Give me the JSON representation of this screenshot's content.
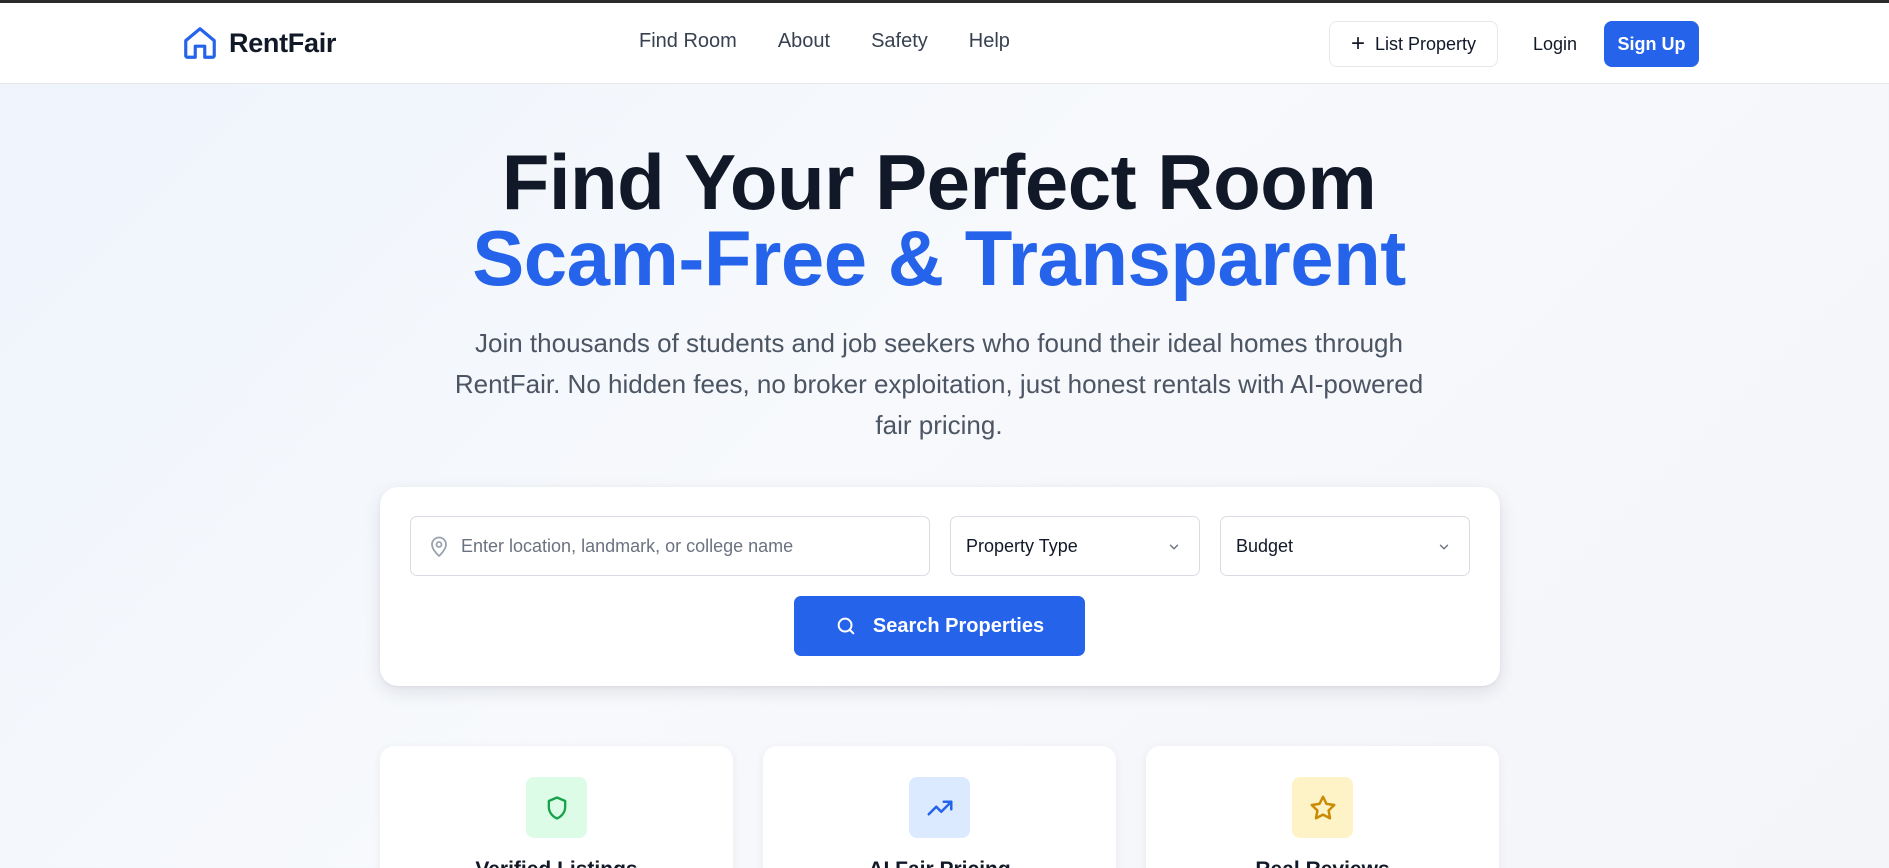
{
  "nav": {
    "brand": "RentFair",
    "links": [
      "Find Room",
      "About",
      "Safety",
      "Help"
    ],
    "list_property": "List Property",
    "login": "Login",
    "signup": "Sign Up"
  },
  "hero": {
    "title_line1": "Find Your Perfect Room",
    "title_line2": "Scam-Free & Transparent",
    "subtitle": "Join thousands of students and job seekers who found their ideal homes through RentFair. No hidden fees, no broker exploitation, just honest rentals with AI-powered fair pricing."
  },
  "search": {
    "location_placeholder": "Enter location, landmark, or college name",
    "location_value": "",
    "property_type": "Property Type",
    "budget": "Budget",
    "button": "Search Properties"
  },
  "features": [
    {
      "title": "Verified Listings",
      "icon": "shield-icon"
    },
    {
      "title": "AI Fair Pricing",
      "icon": "trending-up-icon"
    },
    {
      "title": "Real Reviews",
      "icon": "star-icon"
    }
  ],
  "colors": {
    "accent": "#2563eb",
    "heading": "#111827",
    "green": "#16a34a",
    "amber": "#ca8a04"
  }
}
